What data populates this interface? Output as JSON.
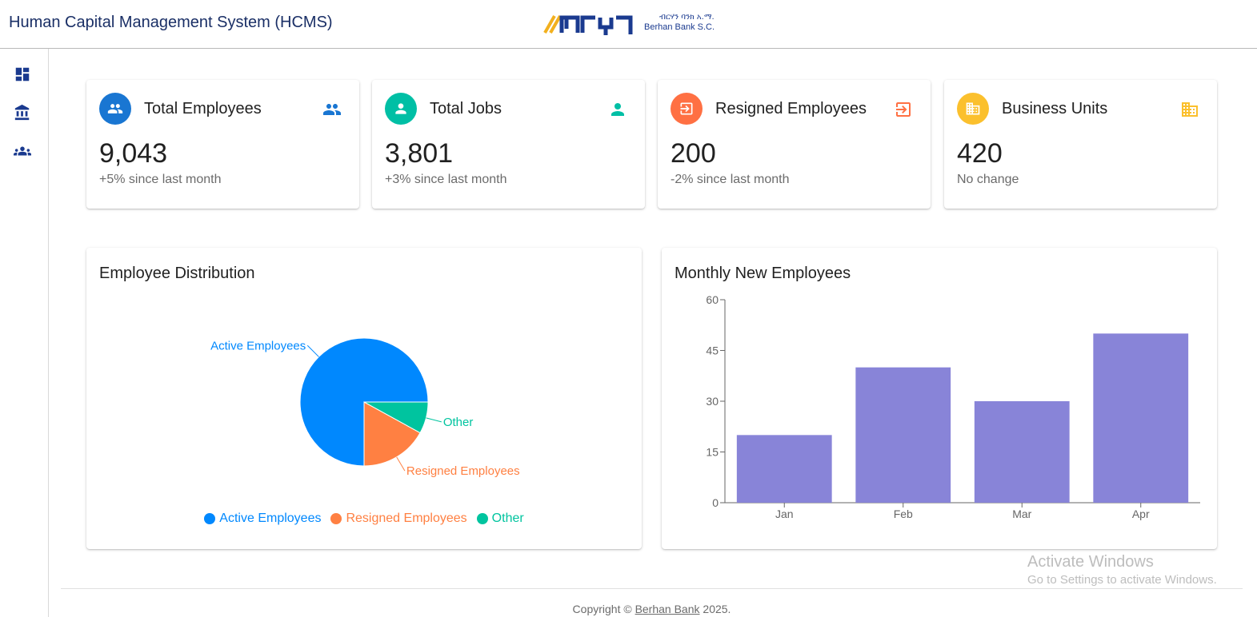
{
  "header": {
    "app_title": "Human Capital Management System (HCMS)",
    "logo_amharic": "ብርሃን ባንክ አ.ማ.",
    "logo_english": "Berhan Bank S.C."
  },
  "sidebar": {
    "items": [
      {
        "name": "dashboard",
        "icon": "dashboard-icon"
      },
      {
        "name": "institution",
        "icon": "bank-icon"
      },
      {
        "name": "employees",
        "icon": "groups-icon"
      }
    ]
  },
  "stats": [
    {
      "title": "Total Employees",
      "value": "9,043",
      "sub": "+5% since last month",
      "color": "#1976d2",
      "side_color": "#1976d2",
      "icon": "people-icon"
    },
    {
      "title": "Total Jobs",
      "value": "3,801",
      "sub": "+3% since last month",
      "color": "#00bfa5",
      "side_color": "#00bfa5",
      "icon": "person-icon"
    },
    {
      "title": "Resigned Employees",
      "value": "200",
      "sub": "-2% since last month",
      "color": "#ff7043",
      "side_color": "#ff7043",
      "icon": "exit-icon"
    },
    {
      "title": "Business Units",
      "value": "420",
      "sub": "No change",
      "color": "#fbc02d",
      "side_color": "#fbc02d",
      "icon": "building-icon"
    }
  ],
  "distribution": {
    "title": "Employee Distribution"
  },
  "monthly": {
    "title": "Monthly New Employees"
  },
  "chart_data": [
    {
      "type": "pie",
      "title": "Employee Distribution",
      "categories": [
        "Active Employees",
        "Resigned Employees",
        "Other"
      ],
      "values": [
        75,
        17,
        8
      ],
      "colors": [
        "#0088fe",
        "#ff8042",
        "#00c49f"
      ],
      "legend": "bottom"
    },
    {
      "type": "bar",
      "title": "Monthly New Employees",
      "categories": [
        "Jan",
        "Feb",
        "Mar",
        "Apr"
      ],
      "values": [
        20,
        40,
        30,
        50
      ],
      "ylim": [
        0,
        60
      ],
      "yticks": [
        0,
        15,
        30,
        45,
        60
      ],
      "color": "#8884d8",
      "grid": false
    }
  ],
  "watermark": {
    "title": "Activate Windows",
    "sub": "Go to Settings to activate Windows."
  },
  "footer": {
    "prefix": "Copyright © ",
    "link": "Berhan Bank",
    "suffix": " 2025."
  }
}
